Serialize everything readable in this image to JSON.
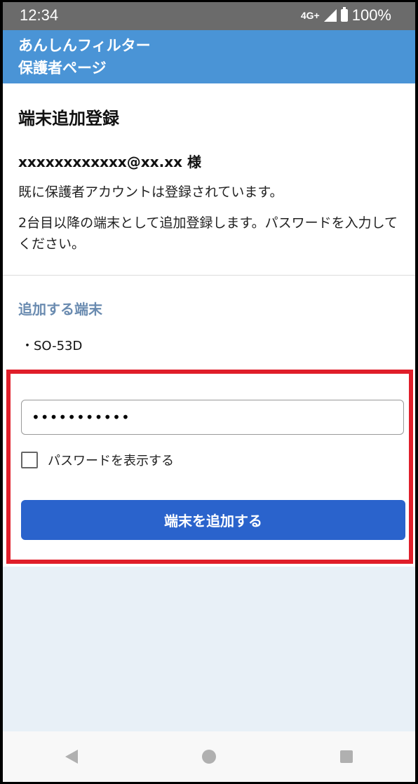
{
  "status_bar": {
    "time": "12:34",
    "network": "4G+",
    "battery": "100%"
  },
  "header": {
    "title": "あんしんフィルター\n保護者ページ"
  },
  "main": {
    "heading": "端末追加登録",
    "email": "xxxxxxxxxxxx@xx.xx 様",
    "notice_1": "既に保護者アカウントは登録されています。",
    "notice_2": "2台目以降の端末として追加登録します。パスワードを入力してください。",
    "device_section": {
      "heading": "追加する端末",
      "items": [
        "・SO-53D"
      ]
    },
    "form": {
      "password_value": "•••••••••••",
      "show_password_label": "パスワードを表示する",
      "submit_label": "端末を追加する"
    }
  },
  "colors": {
    "header_bg": "#4a94d6",
    "button_bg": "#2a63cc",
    "highlight": "#e01e2a"
  },
  "icons": [
    "signal-icon",
    "battery-icon",
    "nav-back-icon",
    "nav-home-icon",
    "nav-recent-icon"
  ]
}
